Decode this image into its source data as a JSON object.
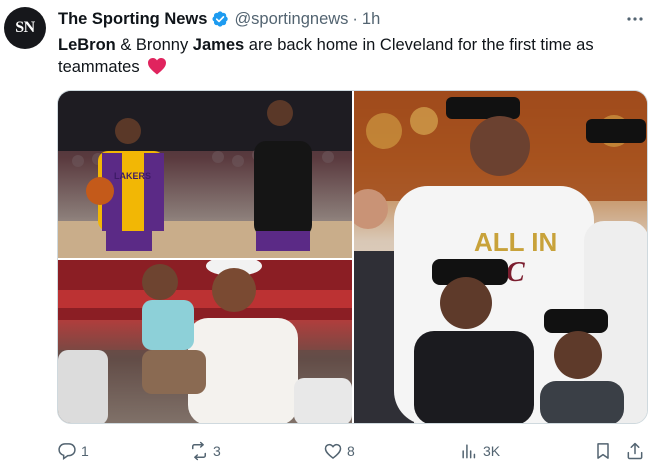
{
  "account": {
    "avatar_text": "SN",
    "display_name": "The Sporting News",
    "handle": "@sportingnews",
    "separator": "·",
    "time": "1h"
  },
  "tweet": {
    "part1": "LeBron",
    "part2": " & Bronny ",
    "part3": "James",
    "part4": " are back home in Cleveland for the first time as teammates"
  },
  "media": {
    "photos": [
      {
        "name": "photo-warmup",
        "jersey_text": "LAKERS"
      },
      {
        "name": "photo-dad-and-son"
      },
      {
        "name": "photo-all-in-celebration",
        "shirt_text_1": "ALL IN",
        "shirt_text_2": "C"
      }
    ]
  },
  "actions": {
    "replies": "1",
    "retweets": "3",
    "likes": "8",
    "views": "3K"
  },
  "colors": {
    "verified": "#1d9bf0",
    "heart": "#e0245e",
    "muted": "#536471"
  }
}
